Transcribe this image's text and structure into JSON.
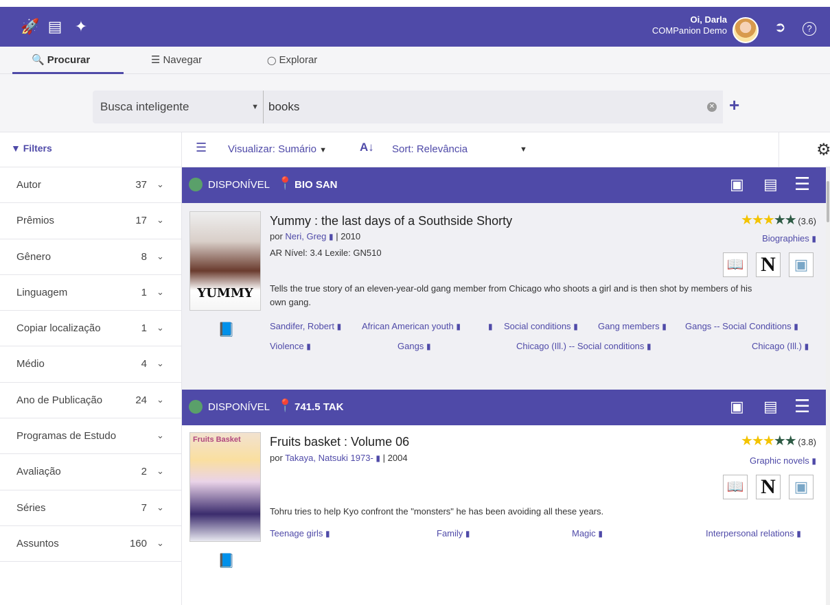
{
  "topbar": {
    "icons": [
      "rocket-icon",
      "checklist-icon",
      "pin-icon"
    ],
    "greeting": "Oi, Darla",
    "org": "COMPanion Demo"
  },
  "tabs": [
    {
      "label": "Procurar",
      "icon": "search-icon"
    },
    {
      "label": "Navegar",
      "icon": "signpost-icon"
    },
    {
      "label": "Explorar",
      "icon": "bike-icon"
    }
  ],
  "search": {
    "type": "Busca inteligente",
    "query": "books"
  },
  "toolbar": {
    "filters": "Filters",
    "view": "Visualizar: Sumário",
    "sort": "Sort: Relevância"
  },
  "facets": [
    {
      "name": "Autor",
      "count": "37"
    },
    {
      "name": "Prêmios",
      "count": "17"
    },
    {
      "name": "Gênero",
      "count": "8"
    },
    {
      "name": "Linguagem",
      "count": "1"
    },
    {
      "name": "Copiar localização",
      "count": "1"
    },
    {
      "name": "Médio",
      "count": "4"
    },
    {
      "name": "Ano de Publicação",
      "count": "24"
    },
    {
      "name": "Programas de Estudo",
      "count": ""
    },
    {
      "name": "Avaliação",
      "count": "2"
    },
    {
      "name": "Séries",
      "count": "7"
    },
    {
      "name": "Assuntos",
      "count": "160"
    }
  ],
  "results": [
    {
      "status": "DISPONÍVEL",
      "call_number": "BIO SAN",
      "title": "Yummy : the last days of a Southside Shorty",
      "author": "Neri, Greg",
      "year": "2010",
      "levels": "AR Nível: 3.4   Lexile: GN510",
      "summary": "Tells the true story of an eleven-year-old gang member from Chicago who shoots a girl and is then shot by members of his own gang.",
      "rating": "(3.6)",
      "rating_value": 3.6,
      "genre": "Biographies",
      "subjects_row1": [
        "Sandifer, Robert",
        "African American youth",
        "",
        "Social conditions",
        "Gang members",
        "Gangs -- Social Conditions"
      ],
      "subjects_row2": [
        "Violence",
        "Gangs",
        "Chicago (Ill.) -- Social conditions",
        "Chicago (Ill.)"
      ]
    },
    {
      "status": "DISPONÍVEL",
      "call_number": "741.5 TAK",
      "title": "Fruits basket : Volume 06",
      "author": "Takaya, Natsuki 1973-",
      "year": "2004",
      "summary": "Tohru tries to help Kyo confront the \"monsters\" he has been avoiding all these years.",
      "rating": "(3.8)",
      "rating_value": 3.8,
      "genre": "Graphic novels",
      "subjects_row1": [
        "Teenage girls",
        "Family",
        "Magic",
        "Interpersonal relations"
      ]
    }
  ],
  "colors": {
    "brand": "#4f4aa8",
    "available": "#5aa06a",
    "star": "#f3c300"
  }
}
